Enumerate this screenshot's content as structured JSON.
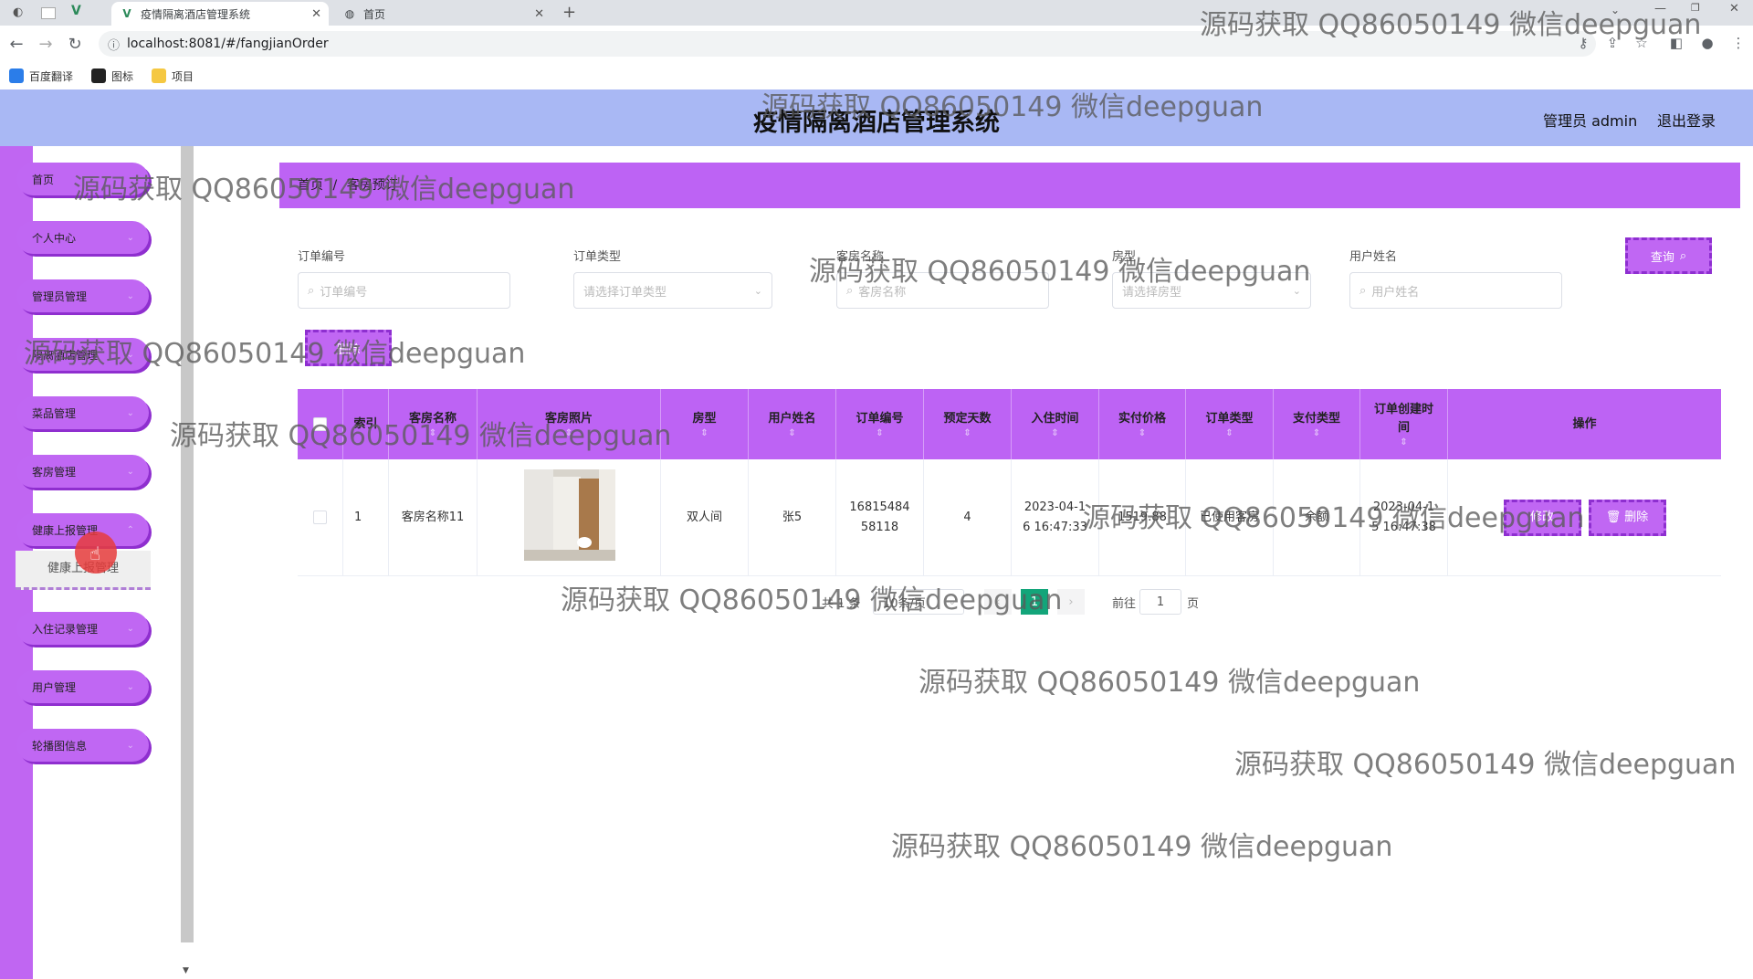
{
  "browser": {
    "tabs": [
      {
        "title": "疫情隔离酒店管理系统",
        "active": true
      },
      {
        "title": "首页",
        "active": false
      }
    ],
    "new_tab_label": "+",
    "url": "localhost:8081/#/fangjianOrder",
    "bookmarks": [
      "百度翻译",
      "图标",
      "项目"
    ]
  },
  "header": {
    "title": "疫情隔离酒店管理系统",
    "user": "管理员 admin",
    "logout": "退出登录"
  },
  "sidebar": {
    "items": [
      {
        "label": "首页"
      },
      {
        "label": "个人中心"
      },
      {
        "label": "管理员管理"
      },
      {
        "label": "隔离酒店管理"
      },
      {
        "label": "菜品管理"
      },
      {
        "label": "客房管理"
      },
      {
        "label": "健康上报管理"
      },
      {
        "label": "入住记录管理"
      },
      {
        "label": "用户管理"
      },
      {
        "label": "轮播图信息"
      }
    ],
    "submenu": "健康上报管理"
  },
  "breadcrumb": {
    "home": "首页",
    "sep": "/",
    "current": "客房预订"
  },
  "filters": {
    "order_no": {
      "label": "订单编号",
      "placeholder": "订单编号"
    },
    "order_type": {
      "label": "订单类型",
      "placeholder": "请选择订单类型"
    },
    "room_name": {
      "label": "客房名称",
      "placeholder": "客房名称"
    },
    "room_type": {
      "label": "房型",
      "placeholder": "请选择房型"
    },
    "user_name": {
      "label": "用户姓名",
      "placeholder": "用户姓名"
    },
    "search_button": "查询"
  },
  "actions": {
    "delete": "删除"
  },
  "table": {
    "columns": [
      "索引",
      "客房名称",
      "客房照片",
      "房型",
      "用户姓名",
      "订单编号",
      "预定天数",
      "入住时间",
      "实付价格",
      "订单类型",
      "支付类型",
      "订单创建时间",
      "操作"
    ],
    "rows": [
      {
        "index": "1",
        "room_name": "客房名称11",
        "room_type": "双人间",
        "user_name": "张5",
        "order_no": "1681548458118",
        "days": "4",
        "checkin_time": "2023-04-16 16:47:33",
        "price": "1519.88",
        "order_type": "已使用客房",
        "pay_type": "余额",
        "created_at": "2023-04-15 16:47:38",
        "edit_label": "修改",
        "delete_label": "删除"
      }
    ]
  },
  "pagination": {
    "total": "共 1 条",
    "page_size": "10条/页",
    "current_page": "1",
    "goto_label": "前往",
    "goto_value": "1",
    "page_suffix": "页"
  },
  "watermark": "源码获取 QQ86050149 微信deepguan",
  "colors": {
    "header_bg": "#a9b8f4",
    "sidebar": "#c066f2",
    "accent": "#bd63f4",
    "pager_active": "#13a57a"
  }
}
